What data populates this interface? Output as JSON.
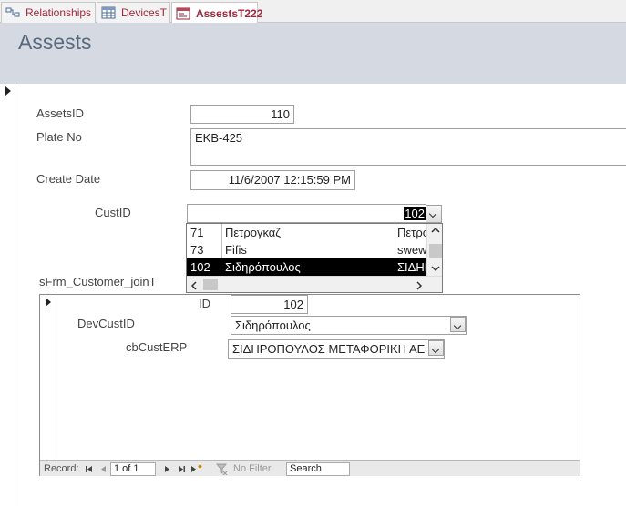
{
  "tabs": [
    {
      "label": "Relationships",
      "icon": "relationships-icon"
    },
    {
      "label": "DevicesT",
      "icon": "table-icon"
    },
    {
      "label": "AssestsT222",
      "icon": "form-icon",
      "active": true
    }
  ],
  "form": {
    "title": "Assests",
    "fields": {
      "assets_id": {
        "label": "AssetsID",
        "value": "110"
      },
      "plate_no": {
        "label": "Plate No",
        "value": "ΕΚΒ-425"
      },
      "create_date": {
        "label": "Create Date",
        "value": "11/6/2007 12:15:59 PM"
      },
      "cust_id": {
        "label": "CustID",
        "value": "102"
      }
    },
    "dropdown_rows": [
      {
        "id": "71",
        "name": "Πετρογκάζ",
        "extra": "Πετρο"
      },
      {
        "id": "73",
        "name": "Fifis",
        "extra": "swew"
      },
      {
        "id": "102",
        "name": "Σιδηρόπουλος",
        "extra": "ΣΙΔΗΡ",
        "selected": true
      }
    ],
    "subform_label": "sFrm_Customer_joinT"
  },
  "subform": {
    "id": {
      "label": "ID",
      "value": "102"
    },
    "dev_cust_id": {
      "label": "DevCustID",
      "value": "Σιδηρόπουλος"
    },
    "cb_cust_erp": {
      "label": "cbCustERP",
      "value": "ΣΙΔΗΡΟΠΟΥΛΟΣ ΜΕΤΑΦΟΡΙΚΗ ΑΕ"
    }
  },
  "navigation": {
    "record_label": "Record:",
    "record_position": "1 of 1",
    "filter_label": "No Filter",
    "search_placeholder": "Search"
  },
  "colors": {
    "tab_text": "#a3263b",
    "header_bg": "#d4d9e2",
    "title": "#5a6a7e"
  }
}
